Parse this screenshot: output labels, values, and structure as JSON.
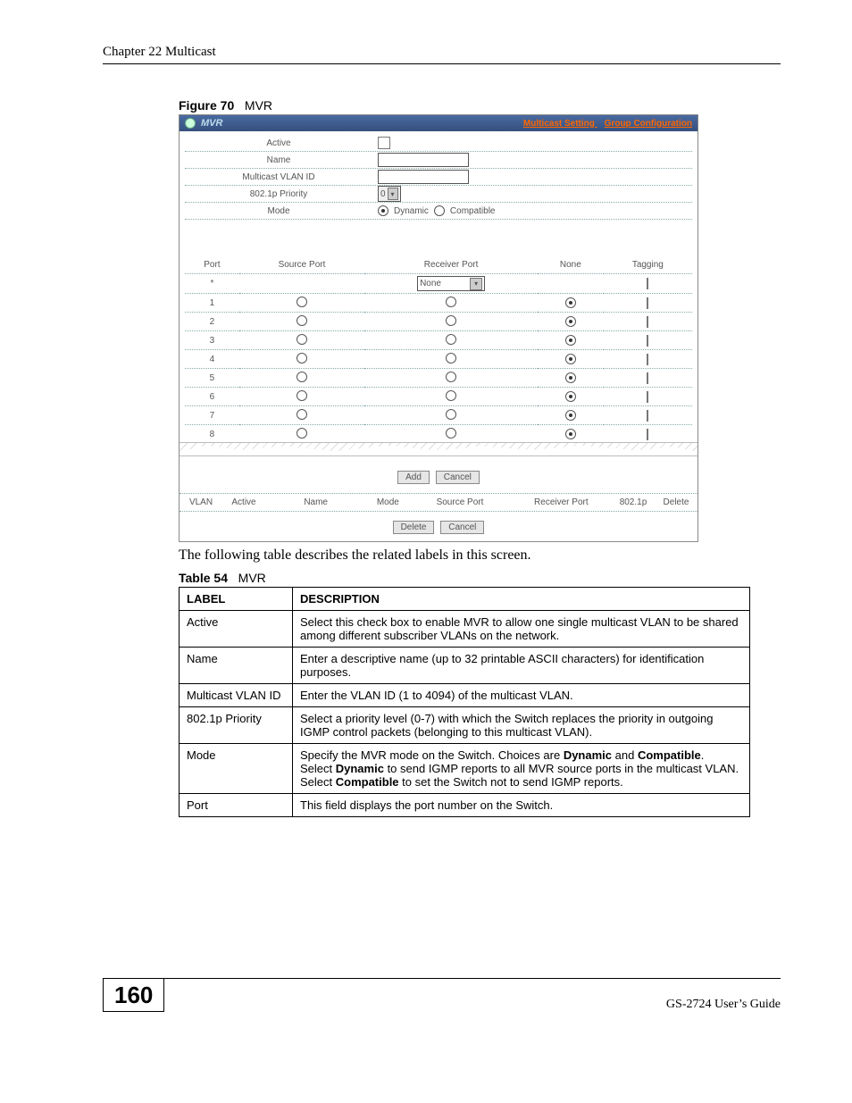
{
  "header": {
    "chapter": "Chapter 22 Multicast"
  },
  "figure": {
    "label": "Figure 70",
    "title": "MVR"
  },
  "screenshot": {
    "title": "MVR",
    "links": {
      "a": "Multicast Setting",
      "b": "Group Configuration"
    },
    "rows": {
      "active": "Active",
      "name": "Name",
      "mvlan": "Multicast VLAN ID",
      "priority": "802.1p Priority",
      "priority_value": "0",
      "mode": "Mode",
      "mode_dynamic": "Dynamic",
      "mode_compatible": "Compatible"
    },
    "port_headers": {
      "port": "Port",
      "source": "Source Port",
      "receiver": "Receiver Port",
      "none": "None",
      "tagging": "Tagging"
    },
    "star_row": {
      "port": "*",
      "receiver_sel": "None"
    },
    "ports": [
      {
        "n": "1"
      },
      {
        "n": "2"
      },
      {
        "n": "3"
      },
      {
        "n": "4"
      },
      {
        "n": "5"
      },
      {
        "n": "6"
      },
      {
        "n": "7"
      },
      {
        "n": "8"
      }
    ],
    "buttons": {
      "add": "Add",
      "cancel": "Cancel",
      "delete": "Delete",
      "cancel2": "Cancel"
    },
    "summary": {
      "vlan": "VLAN",
      "active": "Active",
      "name": "Name",
      "mode": "Mode",
      "source": "Source Port",
      "receiver": "Receiver Port",
      "priority": "802.1p",
      "delete": "Delete"
    }
  },
  "body_text": "The following table describes the related labels in this screen.",
  "table_caption": {
    "label": "Table 54",
    "title": "MVR"
  },
  "desc_table": {
    "head": {
      "label": "LABEL",
      "desc": "DESCRIPTION"
    },
    "rows": [
      {
        "label": "Active",
        "desc": "Select this check box to enable MVR to allow one single multicast VLAN to be shared among different subscriber VLANs on the network."
      },
      {
        "label": "Name",
        "desc": "Enter a descriptive name (up to 32 printable ASCII characters) for identification purposes."
      },
      {
        "label": "Multicast VLAN ID",
        "desc": "Enter the VLAN ID (1 to 4094) of the multicast VLAN."
      },
      {
        "label": "802.1p Priority",
        "desc": "Select a priority level (0-7) with which the Switch replaces the priority in outgoing IGMP control packets (belonging to this multicast VLAN)."
      },
      {
        "label": "Port",
        "desc": "This field displays the port number on the Switch."
      }
    ],
    "mode": {
      "label": "Mode",
      "l1a": "Specify the MVR mode on the Switch. Choices are ",
      "l1b": "Dynamic",
      "l1c": " and ",
      "l1d": "Compatible",
      "l1e": ".",
      "l2a": "Select ",
      "l2b": "Dynamic",
      "l2c": " to send IGMP reports to all MVR source ports in the multicast VLAN.",
      "l3a": "Select ",
      "l3b": "Compatible",
      "l3c": " to set the Switch not to send IGMP reports."
    }
  },
  "footer": {
    "page": "160",
    "guide": "GS-2724 User’s Guide"
  }
}
